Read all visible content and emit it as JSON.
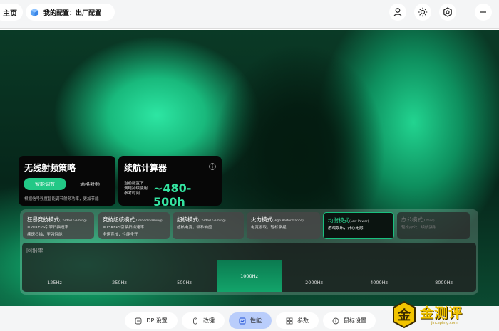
{
  "header": {
    "home_label": "主页",
    "profile_label": "我的配置：出厂配置",
    "icons": [
      "user-icon",
      "brightness-icon",
      "settings-hex-icon",
      "minimize-icon"
    ]
  },
  "strategy": {
    "title": "无线射频策略",
    "active_mode": "智能调节",
    "inactive_mode": "满格射频",
    "note": "根据信号强度智能调节射频功率，更加节能"
  },
  "calculator": {
    "title": "续航计算器",
    "sub_lines": [
      "当前配置下",
      "满电持续使用",
      "参考时间"
    ],
    "value": "~480-500h"
  },
  "modes": [
    {
      "name": "狂暴竞技模式",
      "tag": "(Corded Gaming)",
      "desc": [
        "≥20KFPS引擎扫描速率",
        "疾速扫描，至强性能"
      ],
      "state": "normal"
    },
    {
      "name": "竞技超核模式",
      "tag": "(Corded Gaming)",
      "desc": [
        "≥15KFPS引擎扫描速率",
        "全速竞技，性能全开"
      ],
      "state": "normal"
    },
    {
      "name": "超核模式",
      "tag": "(Corded Gaming)",
      "desc": [
        "超核电竞，微秒响应"
      ],
      "state": "normal"
    },
    {
      "name": "火力模式",
      "tag": "(High Performance)",
      "desc": [
        "电竞游戏，轻松拿捏"
      ],
      "state": "normal"
    },
    {
      "name": "均衡模式",
      "tag": "(Low Power)",
      "desc": [
        "游戏娱乐，开心无虑"
      ],
      "state": "selected"
    },
    {
      "name": "办公模式",
      "tag": "(Office)",
      "desc": [
        "轻松办公，续航强耐"
      ],
      "state": "dim"
    }
  ],
  "polling": {
    "title": "回报率",
    "rates": [
      "125Hz",
      "250Hz",
      "500Hz",
      "1000Hz",
      "2000Hz",
      "4000Hz",
      "8000Hz"
    ],
    "selected": "1000Hz"
  },
  "nav": {
    "tabs": [
      {
        "label": "DPI设置",
        "icon": "dpi-icon",
        "active": false
      },
      {
        "label": "改键",
        "icon": "mouse-icon",
        "active": false
      },
      {
        "label": "性能",
        "icon": "performance-icon",
        "active": true
      },
      {
        "label": "参数",
        "icon": "params-icon",
        "active": false
      },
      {
        "label": "鼠标设置",
        "icon": "info-icon",
        "active": false
      }
    ]
  },
  "watermark": {
    "text": "金测评",
    "url": "jincepimg.com"
  },
  "colors": {
    "accent_green": "#22c886",
    "nav_active": "#b9cdfb"
  }
}
